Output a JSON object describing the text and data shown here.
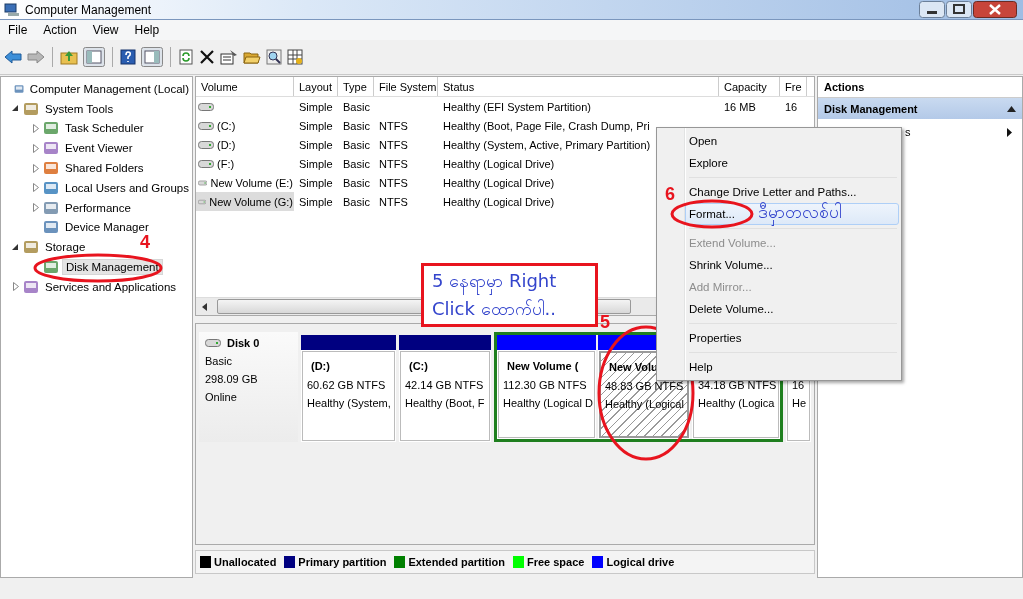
{
  "window": {
    "title": "Computer Management"
  },
  "menu": [
    "File",
    "Action",
    "View",
    "Help"
  ],
  "tree": [
    {
      "label": "Computer Management (Local)",
      "selected": false,
      "children": [
        {
          "label": "System Tools",
          "expanded": true,
          "selected": false,
          "children": [
            {
              "label": "Task Scheduler",
              "expanded": false,
              "selected": false
            },
            {
              "label": "Event Viewer",
              "expanded": false,
              "selected": false
            },
            {
              "label": "Shared Folders",
              "expanded": false,
              "selected": false
            },
            {
              "label": "Local Users and Groups",
              "expanded": false,
              "selected": false
            },
            {
              "label": "Performance",
              "expanded": false,
              "selected": false
            },
            {
              "label": "Device Manager",
              "selected": false
            }
          ]
        },
        {
          "label": "Storage",
          "expanded": true,
          "selected": false,
          "children": [
            {
              "label": "Disk Management",
              "selected": true
            }
          ]
        },
        {
          "label": "Services and Applications",
          "expanded": false,
          "selected": false
        }
      ]
    }
  ],
  "table": {
    "columns": [
      "Volume",
      "Layout",
      "Type",
      "File System",
      "Status",
      "Capacity",
      "Fre"
    ],
    "rows": [
      {
        "layout": "Simple",
        "type": "Basic",
        "status": "Healthy (EFI System Partition)",
        "capacity": "16 MB",
        "free": "16",
        "selected": false
      },
      {
        "volume": "(C:)",
        "layout": "Simple",
        "type": "Basic",
        "fs": "NTFS",
        "status": "Healthy (Boot, Page File, Crash Dump, Pri",
        "selected": false
      },
      {
        "volume": "(D:)",
        "layout": "Simple",
        "type": "Basic",
        "fs": "NTFS",
        "status": "Healthy (System, Active, Primary Partition)",
        "selected": false
      },
      {
        "volume": "(F:)",
        "layout": "Simple",
        "type": "Basic",
        "fs": "NTFS",
        "status": "Healthy (Logical Drive)",
        "selected": false
      },
      {
        "volume": "New Volume (E:)",
        "layout": "Simple",
        "type": "Basic",
        "fs": "NTFS",
        "status": "Healthy (Logical Drive)",
        "selected": false
      },
      {
        "volume": "New Volume (G:)",
        "layout": "Simple",
        "type": "Basic",
        "fs": "NTFS",
        "status": "Healthy (Logical Drive)",
        "selected": true
      }
    ]
  },
  "disk": {
    "name": "Disk 0",
    "type": "Basic",
    "size": "298.09 GB",
    "status": "Online",
    "partitions": [
      {
        "kind": "primary",
        "name": "(D:)",
        "size": "60.62 GB NTFS",
        "status": "Healthy (System,",
        "selected": false
      },
      {
        "kind": "primary",
        "name": "(C:)",
        "size": "42.14 GB NTFS",
        "status": "Healthy (Boot, F",
        "selected": false
      },
      {
        "kind": "extended",
        "children": [
          {
            "kind": "logical",
            "name": "New Volume  (",
            "size": "112.30 GB NTFS",
            "status": "Healthy (Logical D",
            "selected": false
          },
          {
            "kind": "logical",
            "name": "New Volu",
            "size": "48.83 GB NTFS",
            "status": "Healthy (Logical",
            "selected": true
          },
          {
            "size": "34.18 GB NTFS",
            "status": "Healthy (Logica",
            "selected": false
          }
        ]
      },
      {
        "size": "16",
        "status": "He",
        "selected": false
      }
    ]
  },
  "legend": [
    {
      "label": "Unallocated",
      "color": "#000000"
    },
    {
      "label": "Primary partition",
      "color": "#000080"
    },
    {
      "label": "Extended partition",
      "color": "#008000"
    },
    {
      "label": "Free space",
      "color": "#00ff00"
    },
    {
      "label": "Logical drive",
      "color": "#0000ff"
    }
  ],
  "actions": {
    "title": "Actions",
    "section": "Disk Management",
    "items": [
      {
        "label": "s"
      }
    ]
  },
  "context_menu": [
    {
      "kind": "item",
      "label": "Open",
      "disabled": false,
      "selected": false
    },
    {
      "kind": "item",
      "label": "Explore",
      "disabled": false,
      "selected": false
    },
    {
      "kind": "separator"
    },
    {
      "kind": "item",
      "label": "Change Drive Letter and Paths...",
      "disabled": false,
      "selected": false
    },
    {
      "kind": "item",
      "label": "Format...",
      "disabled": false,
      "selected": true
    },
    {
      "kind": "separator"
    },
    {
      "kind": "item",
      "label": "Extend Volume...",
      "disabled": true,
      "selected": false
    },
    {
      "kind": "item",
      "label": "Shrink Volume...",
      "disabled": false,
      "selected": false
    },
    {
      "kind": "item",
      "label": "Add Mirror...",
      "disabled": true,
      "selected": false
    },
    {
      "kind": "item",
      "label": "Delete Volume...",
      "disabled": false,
      "selected": false
    },
    {
      "kind": "separator"
    },
    {
      "kind": "item",
      "label": "Properties",
      "disabled": false,
      "selected": false
    },
    {
      "kind": "separator"
    },
    {
      "kind": "item",
      "label": "Help",
      "disabled": false,
      "selected": false
    }
  ],
  "annotations": {
    "steps": [
      "4",
      "5",
      "6"
    ],
    "note_lines": [
      "5 နေရာမှာ Right",
      "Click ထောက်ပါ.."
    ],
    "format_note": "ဒီမှာတလစ်ပါ"
  }
}
